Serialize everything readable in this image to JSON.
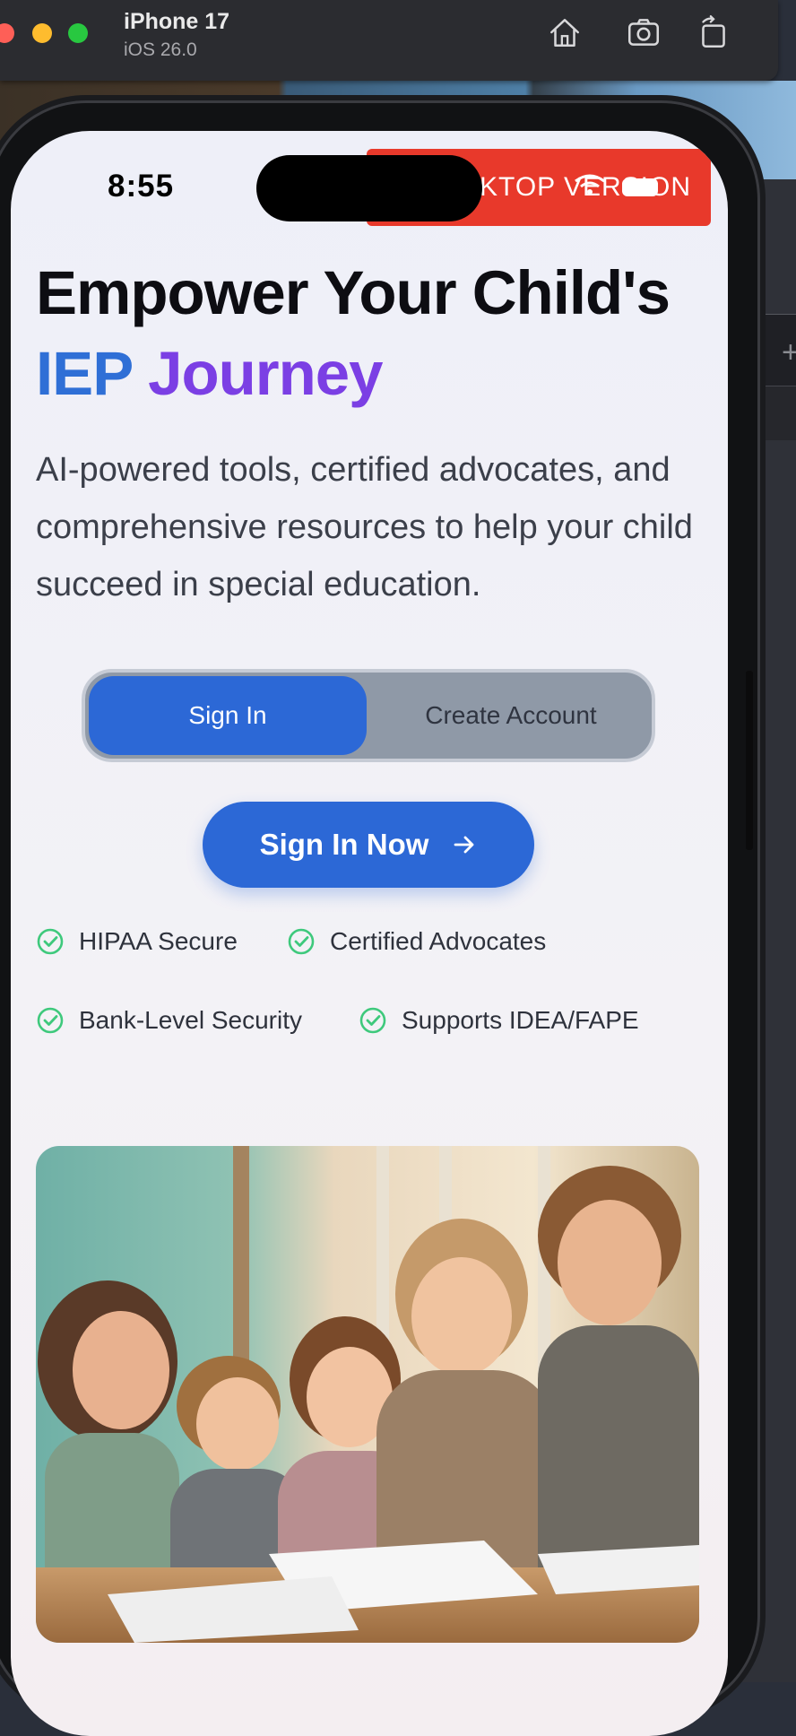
{
  "simulator": {
    "device_name": "iPhone 17",
    "os_version": "iOS 26.0",
    "icons": [
      "home-icon",
      "screenshot-icon",
      "rotate-icon"
    ]
  },
  "status_bar": {
    "time": "8:55",
    "banner_text": "DESKTOP VERSION"
  },
  "hero": {
    "title_line1": "Empower Your Child's",
    "title_word_blue": "IEP",
    "title_word_purple": "Journey",
    "subtitle": "AI-powered tools, certified advocates, and comprehensive resources to help your child succeed in special education."
  },
  "auth_toggle": {
    "sign_in": "Sign In",
    "create_account": "Create Account",
    "selected": "Sign In"
  },
  "cta": {
    "label": "Sign In Now",
    "icon": "arrow-right-icon"
  },
  "features": [
    "HIPAA Secure",
    "Certified Advocates",
    "Bank-Level Security",
    "Supports IDEA/FAPE"
  ],
  "colors": {
    "primary_blue": "#2c68d6",
    "accent_purple": "#7b3fe4",
    "check_green": "#3ec97c",
    "banner_red": "#e8392b"
  }
}
